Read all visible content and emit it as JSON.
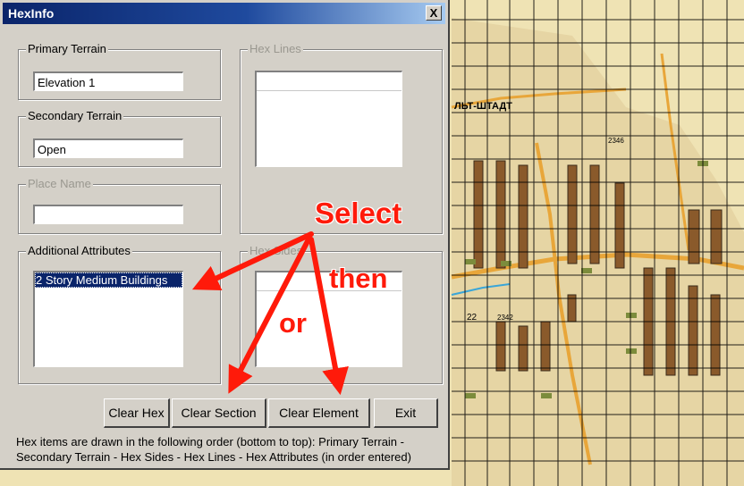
{
  "window": {
    "title": "HexInfo",
    "close_label": "X"
  },
  "groups": {
    "primary_terrain": {
      "label": "Primary Terrain",
      "value": "Elevation 1"
    },
    "secondary_terrain": {
      "label": "Secondary Terrain",
      "value": "Open"
    },
    "place_name": {
      "label": "Place Name",
      "value": ""
    },
    "additional_attributes": {
      "label": "Additional Attributes",
      "items": [
        "2 Story Medium Buildings"
      ]
    },
    "hex_lines": {
      "label": "Hex Lines"
    },
    "hex_sides": {
      "label": "Hex Sides"
    }
  },
  "buttons": {
    "clear_hex": "Clear Hex",
    "clear_section": "Clear Section",
    "clear_element": "Clear Element",
    "exit": "Exit"
  },
  "note": "Hex items are drawn in the following order (bottom to top):  Primary Terrain - Secondary Terrain - Hex Sides - Hex Lines - Hex Attributes (in order entered)",
  "annotations": {
    "select": "Select",
    "then": "then",
    "or": "or",
    "color": "#ff1a0a"
  },
  "map": {
    "labels": [
      "ЛЬТ-ШТАДТ",
      "2346",
      "2342",
      "22"
    ],
    "colors": {
      "paper": "#efe3b4",
      "road": "#e8a63a",
      "water": "#3aa6d8",
      "building": "#8a5a2b",
      "green": "#7c8c3c",
      "grid": "#000000"
    }
  }
}
